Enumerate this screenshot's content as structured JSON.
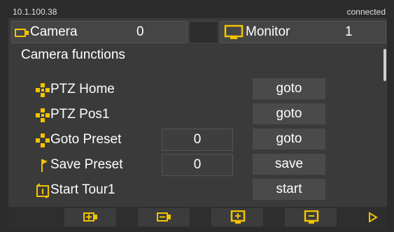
{
  "status": {
    "ip": "10.1.100.38",
    "connection": "connected"
  },
  "camera": {
    "label": "Camera",
    "value": "0",
    "icon": "camera-icon"
  },
  "monitor": {
    "label": "Monitor",
    "value": "1",
    "icon": "monitor-icon"
  },
  "section": {
    "title": "Camera functions"
  },
  "rows": [
    {
      "label": "PTZ Home",
      "param": "",
      "action": "goto",
      "icon": "ptz-home-icon"
    },
    {
      "label": "PTZ Pos1",
      "param": "",
      "action": "goto",
      "icon": "ptz-pos1-icon"
    },
    {
      "label": "Goto Preset",
      "param": "0",
      "action": "goto",
      "icon": "ptz-preset-icon"
    },
    {
      "label": "Save Preset",
      "param": "0",
      "action": "save",
      "icon": "flag-icon"
    },
    {
      "label": "Start Tour1",
      "param": "",
      "action": "start",
      "icon": "tour-icon"
    }
  ],
  "toolbar": {
    "buttons": [
      "camera-next-icon",
      "camera-prev-icon",
      "monitor-add-icon",
      "monitor-remove-icon",
      "play-icon"
    ]
  },
  "colors": {
    "accent": "#f2c400",
    "background": "#3a3a3a",
    "text": "#ffffff"
  }
}
